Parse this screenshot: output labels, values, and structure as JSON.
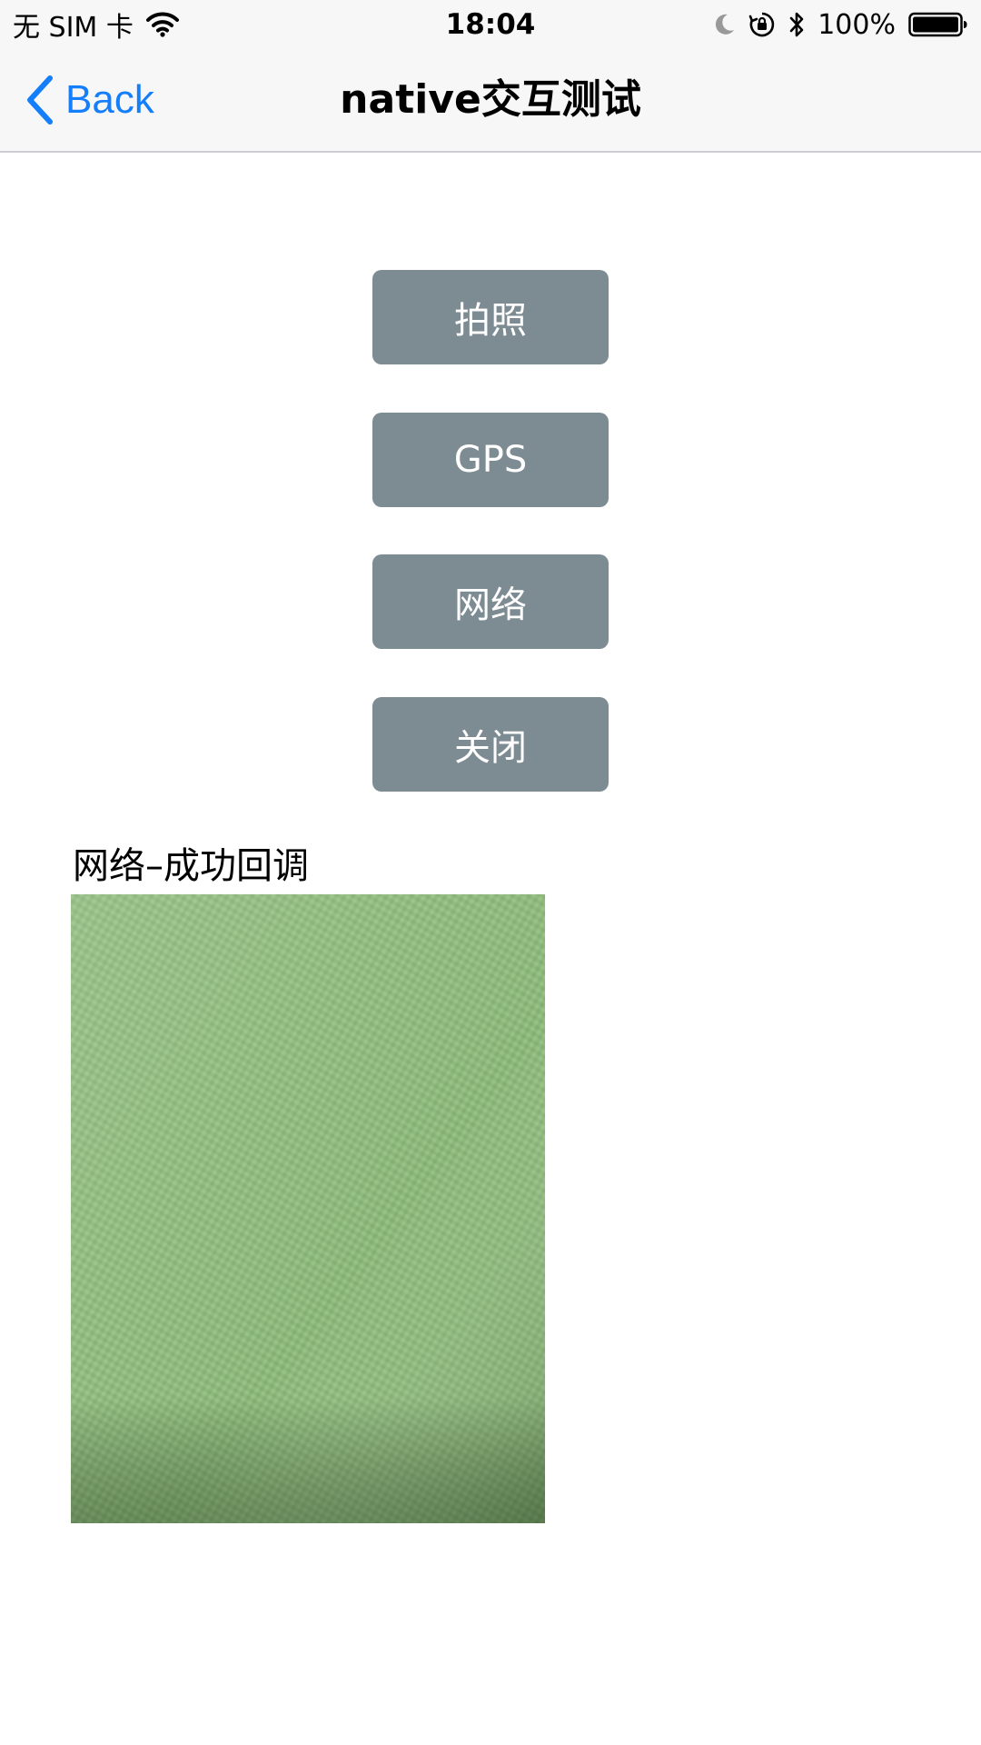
{
  "status_bar": {
    "carrier": "无 SIM 卡",
    "time": "18:04",
    "battery": "100%",
    "icons": [
      "wifi-icon",
      "moon-icon",
      "rotation-lock-icon",
      "bluetooth-icon",
      "battery-icon"
    ]
  },
  "nav": {
    "back_label": "Back",
    "title": "native交互测试",
    "accent_color": "#147efb"
  },
  "buttons": [
    {
      "label": "拍照"
    },
    {
      "label": "GPS"
    },
    {
      "label": "网络"
    },
    {
      "label": "关闭"
    }
  ],
  "result": {
    "label": "网络–成功回调"
  },
  "colors": {
    "button_bg": "#7d8b92",
    "bar_bg": "#f7f7f7",
    "image_green": "#8db87b"
  }
}
